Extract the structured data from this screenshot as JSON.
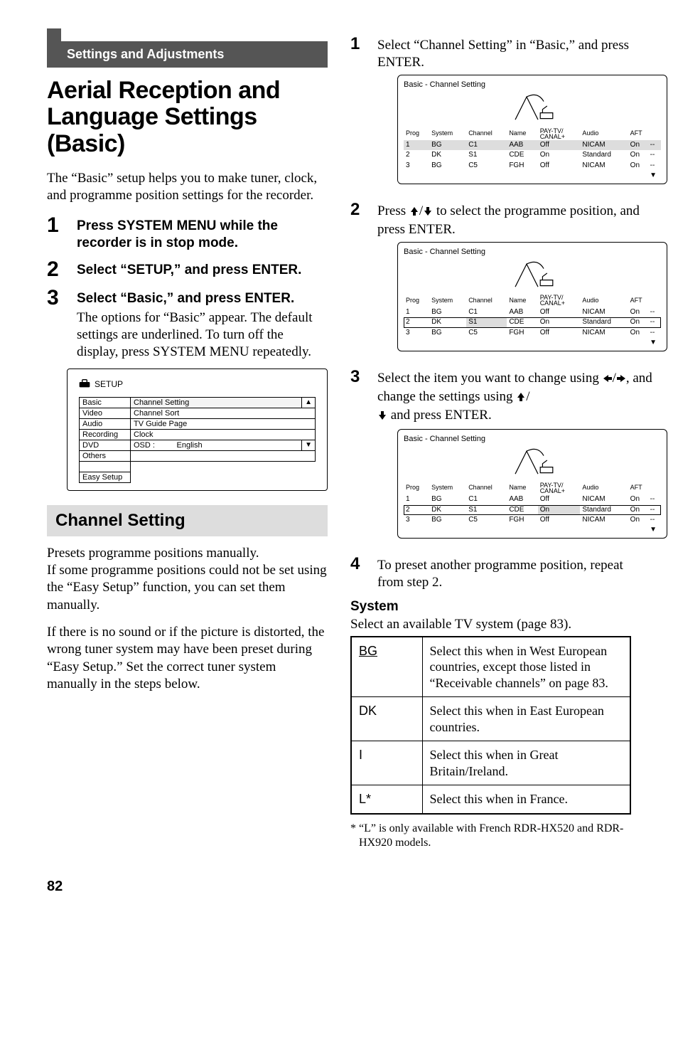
{
  "chapter_label": "Settings and Adjustments",
  "main_heading": "Aerial Reception and Language Settings (Basic)",
  "intro_para": "The “Basic” setup helps you to make tuner, clock, and programme position settings for the recorder.",
  "left_steps": [
    {
      "num": "1",
      "lead": "Press SYSTEM MENU while the recorder is in stop mode.",
      "rest": ""
    },
    {
      "num": "2",
      "lead": "Select “SETUP,” and press ENTER.",
      "rest": ""
    },
    {
      "num": "3",
      "lead": "Select “Basic,” and press ENTER.",
      "rest": "The options for “Basic” appear. The default settings are underlined.\nTo turn off the display, press SYSTEM MENU repeatedly."
    }
  ],
  "setup_figure": {
    "title": "SETUP",
    "menu": [
      "Basic",
      "Video",
      "Audio",
      "Recording",
      "DVD",
      "Others",
      "",
      "Easy Setup"
    ],
    "items": [
      "Channel Setting",
      "Channel Sort",
      "TV Guide Page",
      "Clock",
      "OSD :"
    ],
    "osd_value": "English"
  },
  "section_heading": "Channel Setting",
  "section_para1": "Presets programme positions manually.\nIf some programme positions could not be set using the “Easy Setup” function, you can set them manually.",
  "section_para2": "If there is no sound or if the picture is distorted, the wrong tuner system may have been preset during “Easy Setup.” Set the correct tuner system manually in the steps below.",
  "right_steps": {
    "s1": "Select “Channel Setting” in “Basic,” and press ENTER.",
    "s2a": "Press ",
    "s2b": " to select the programme position, and press ENTER.",
    "s3a": "Select the item you want to change using ",
    "s3b": ", and change the settings using ",
    "s3c": " and press ENTER.",
    "s4": "To preset another programme position, repeat from step 2."
  },
  "ch_fig_title": "Basic - Channel Setting",
  "ch_headers": [
    "Prog",
    "System",
    "Channel",
    "Name",
    "PAY-TV/\nCANAL+",
    "Audio",
    "AFT",
    ""
  ],
  "ch_rows": [
    {
      "prog": "1",
      "system": "BG",
      "channel": "C1",
      "name": "AAB",
      "pay": "Off",
      "audio": "NICAM",
      "aft": "On",
      "extra": "--"
    },
    {
      "prog": "2",
      "system": "DK",
      "channel": "S1",
      "name": "CDE",
      "pay": "On",
      "audio": "Standard",
      "aft": "On",
      "extra": "--"
    },
    {
      "prog": "3",
      "system": "BG",
      "channel": "C5",
      "name": "FGH",
      "pay": "Off",
      "audio": "NICAM",
      "aft": "On",
      "extra": "--"
    }
  ],
  "system_heading": "System",
  "system_intro": "Select an available TV system (page 83).",
  "system_table": [
    {
      "code": "BG",
      "desc": "Select this when in West European countries, except those listed in “Receivable channels” on page 83."
    },
    {
      "code": "DK",
      "desc": "Select this when in East European countries."
    },
    {
      "code": "I",
      "desc": "Select this when in Great Britain/Ireland."
    },
    {
      "code": "L*",
      "desc": "Select this when in France."
    }
  ],
  "footnote": "* “L” is only available with French RDR-HX520 and RDR-HX920 models.",
  "page_number": "82"
}
